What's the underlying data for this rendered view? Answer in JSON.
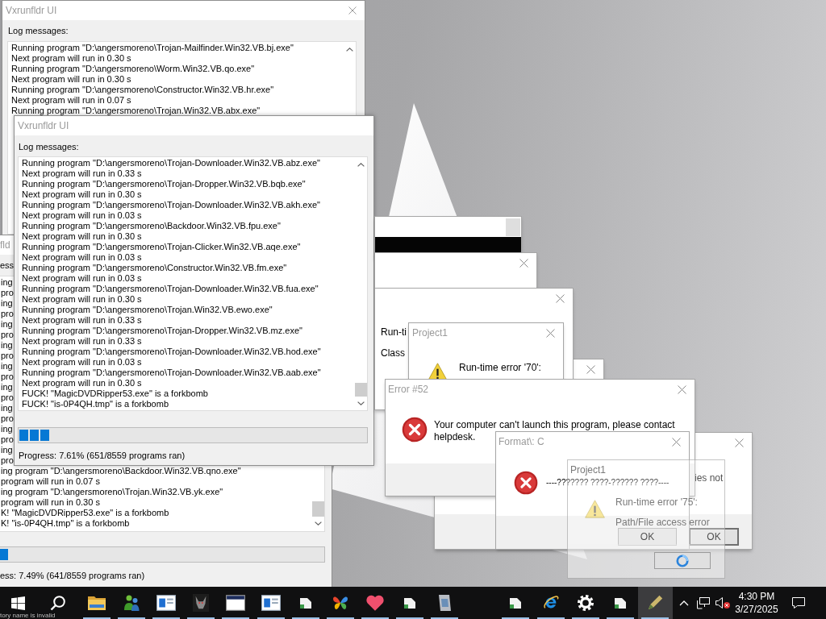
{
  "log_windows": [
    {
      "title": "Vxrunfldr UI",
      "log_label": "Log messages:",
      "lines": [
        "Running program \"D:\\angersmoreno\\Trojan-Mailfinder.Win32.VB.bj.exe\"",
        "Next program will run in 0.30 s",
        "Running program \"D:\\angersmoreno\\Worm.Win32.VB.qo.exe\"",
        "Next program will run in 0.30 s",
        "Running program \"D:\\angersmoreno\\Constructor.Win32.VB.hr.exe\"",
        "Next program will run in 0.07 s",
        "Running program \"D:\\angersmoreno\\Trojan.Win32.VB.abx.exe\""
      ]
    },
    {
      "title": "Vxrunfldr UI",
      "log_label": "Log messages:",
      "lines": [
        "Running program \"D:\\angersmoreno\\Trojan-Downloader.Win32.VB.abz.exe\"",
        "Next program will run in 0.33 s",
        "Running program \"D:\\angersmoreno\\Trojan-Dropper.Win32.VB.bqb.exe\"",
        "Next program will run in 0.30 s",
        "Running program \"D:\\angersmoreno\\Trojan-Downloader.Win32.VB.akh.exe\"",
        "Next program will run in 0.03 s",
        "Running program \"D:\\angersmoreno\\Backdoor.Win32.VB.fpu.exe\"",
        "Next program will run in 0.30 s",
        "Running program \"D:\\angersmoreno\\Trojan-Clicker.Win32.VB.aqe.exe\"",
        "Next program will run in 0.03 s",
        "Running program \"D:\\angersmoreno\\Constructor.Win32.VB.fm.exe\"",
        "Next program will run in 0.03 s",
        "Running program \"D:\\angersmoreno\\Trojan-Downloader.Win32.VB.fua.exe\"",
        "Next program will run in 0.30 s",
        "Running program \"D:\\angersmoreno\\Trojan.Win32.VB.ewo.exe\"",
        "Next program will run in 0.33 s",
        "Running program \"D:\\angersmoreno\\Trojan-Dropper.Win32.VB.mz.exe\"",
        "Next program will run in 0.33 s",
        "Running program \"D:\\angersmoreno\\Trojan-Downloader.Win32.VB.hod.exe\"",
        "Next program will run in 0.03 s",
        "Running program \"D:\\angersmoreno\\Trojan-Downloader.Win32.VB.aab.exe\"",
        "Next program will run in 0.30 s",
        "FUCK! \"MagicDVDRipper53.exe\" is a forkbomb",
        "FUCK! \"is-0P4QH.tmp\" is a forkbomb"
      ],
      "progress": {
        "level": 0.09,
        "text": "Progress: 7.61% (651/8559 programs ran)"
      }
    },
    {
      "title": "fld",
      "log_label": "ess",
      "lines": [
        "ing",
        "pro",
        "ing",
        "pro",
        "ing",
        "pro",
        "ing",
        "pro",
        "ing",
        "pro",
        "ing",
        "pro",
        "ing",
        "pro",
        "ing",
        "pro",
        "ing",
        "pro",
        "ing program \"D:\\angersmoreno\\Backdoor.Win32.VB.qno.exe\"",
        "program will run in 0.07 s",
        "ing program \"D:\\angersmoreno\\Trojan.Win32.VB.yk.exe\"",
        "program will run in 0.30 s",
        "K! \"MagicDVDRipper53.exe\" is a forkbomb",
        "K! \"is-0P4QH.tmp\" is a forkbomb"
      ],
      "progress": {
        "level": 0.025,
        "text": "ess: 7.49% (641/8559 programs ran)"
      }
    }
  ],
  "dialogs": [
    {
      "kind": "picture",
      "faded": false
    },
    {
      "kind": "blank",
      "faded": false
    },
    {
      "kind": "message",
      "lines": [
        "Run-ti",
        "Class"
      ],
      "faded": false
    },
    {
      "kind": "message",
      "title": "Project1",
      "lines": [
        "Run-time error '70':"
      ],
      "faded": false
    },
    {
      "kind": "blank",
      "faded": false
    },
    {
      "kind": "message",
      "title": "Error #52",
      "lines": [
        "Your computer can't launch this program, please contact",
        "helpdesk."
      ],
      "faded": false
    },
    {
      "kind": "message",
      "title": "Format\\: C",
      "lines": [
        "----??????? ????-?????? ????----"
      ],
      "buttons": [
        "OK"
      ],
      "faded": false
    },
    {
      "kind": "message",
      "lines": [
        "ies not"
      ],
      "buttons": [
        "OK"
      ],
      "faded": false
    },
    {
      "kind": "message",
      "title": "Project1",
      "lines": [
        "Run-time error '75':",
        "Path/File access error"
      ],
      "faded": true
    }
  ],
  "taskbar": {
    "apps": [
      {
        "running": true,
        "selected": false
      },
      {
        "running": true,
        "selected": false
      },
      {
        "running": true,
        "selected": false
      },
      {
        "running": true,
        "selected": false
      },
      {
        "running": true,
        "selected": false
      },
      {
        "running": true,
        "selected": false
      },
      {
        "running": true,
        "selected": false
      },
      {
        "running": true,
        "selected": false
      },
      {
        "running": true,
        "selected": false
      },
      {
        "running": true,
        "selected": false
      },
      {
        "running": true,
        "selected": false
      },
      {
        "running": true,
        "selected": false
      },
      {
        "running": true,
        "selected": false
      },
      {
        "running": true,
        "selected": false
      },
      {
        "running": true,
        "selected": false
      },
      {
        "running": true,
        "selected": true
      }
    ],
    "clock": {
      "time": "4:30 PM",
      "date": "3/27/2025"
    },
    "stray_text": "tory name is invalid"
  }
}
